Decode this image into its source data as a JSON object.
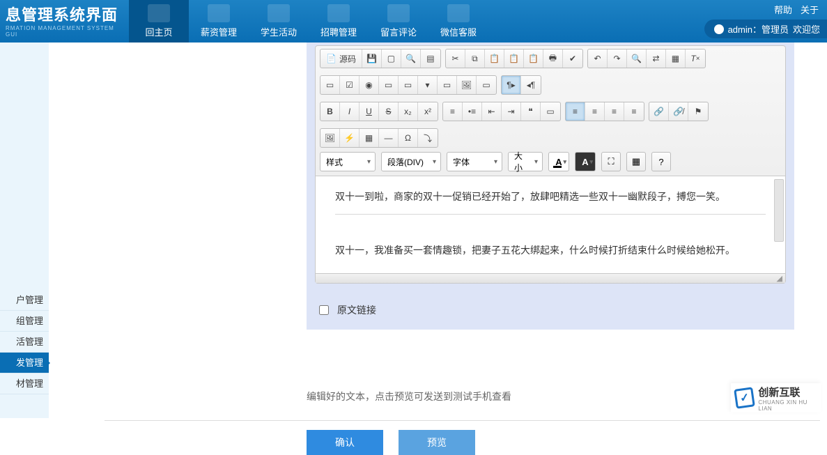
{
  "header": {
    "logo_title": "息管理系统界面",
    "logo_sub": "RMATION MANAGEMENT SYSTEM GUI",
    "nav": [
      {
        "label": "回主页",
        "active": true
      },
      {
        "label": "薪资管理"
      },
      {
        "label": "学生活动"
      },
      {
        "label": "招聘管理"
      },
      {
        "label": "留言评论"
      },
      {
        "label": "微信客服"
      }
    ],
    "top_links": [
      "帮助",
      "关于"
    ],
    "user_label": "admin：管理员",
    "welcome": "欢迎您"
  },
  "sidebar": {
    "items": [
      {
        "label": "户管理"
      },
      {
        "label": "组管理"
      },
      {
        "label": "活管理"
      },
      {
        "label": "发管理",
        "active": true
      },
      {
        "label": "材管理"
      }
    ]
  },
  "editor": {
    "source_label": "源码",
    "combos": {
      "style": "样式",
      "format": "段落(DIV)",
      "font": "字体",
      "size": "大小"
    },
    "content_p1": "双十一到啦，商家的双十一促销已经开始了，放肆吧精选一些双十一幽默段子，搏您一笑。",
    "content_p2": "双十一，我准备买一套情趣锁，把妻子五花大绑起来，什么时候打折结束什么时候给她松开。",
    "orig_link_label": "原文链接",
    "help_text": "编辑好的文本，点击预览可发送到测试手机查看"
  },
  "buttons": {
    "confirm": "确认",
    "preview": "预览"
  },
  "brand": {
    "cn": "创新互联",
    "en": "CHUANG XIN HU LIAN"
  }
}
